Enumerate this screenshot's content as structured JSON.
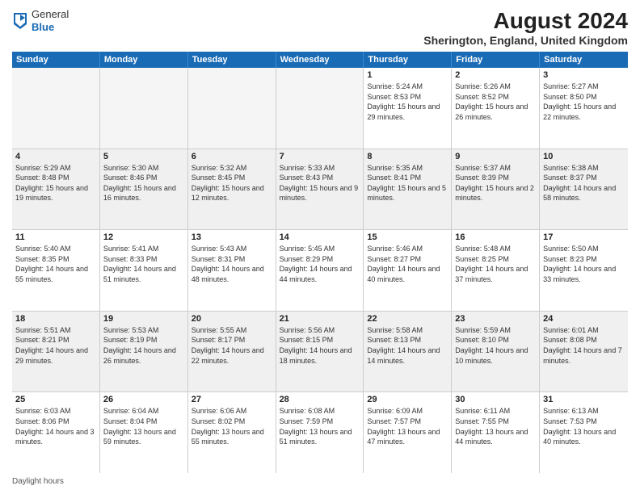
{
  "header": {
    "logo_line1": "General",
    "logo_line2": "Blue",
    "main_title": "August 2024",
    "sub_title": "Sherington, England, United Kingdom"
  },
  "days_of_week": [
    "Sunday",
    "Monday",
    "Tuesday",
    "Wednesday",
    "Thursday",
    "Friday",
    "Saturday"
  ],
  "rows": [
    [
      {
        "day": "",
        "text": "",
        "empty": true
      },
      {
        "day": "",
        "text": "",
        "empty": true
      },
      {
        "day": "",
        "text": "",
        "empty": true
      },
      {
        "day": "",
        "text": "",
        "empty": true
      },
      {
        "day": "1",
        "text": "Sunrise: 5:24 AM\nSunset: 8:53 PM\nDaylight: 15 hours\nand 29 minutes."
      },
      {
        "day": "2",
        "text": "Sunrise: 5:26 AM\nSunset: 8:52 PM\nDaylight: 15 hours\nand 26 minutes."
      },
      {
        "day": "3",
        "text": "Sunrise: 5:27 AM\nSunset: 8:50 PM\nDaylight: 15 hours\nand 22 minutes."
      }
    ],
    [
      {
        "day": "4",
        "text": "Sunrise: 5:29 AM\nSunset: 8:48 PM\nDaylight: 15 hours\nand 19 minutes."
      },
      {
        "day": "5",
        "text": "Sunrise: 5:30 AM\nSunset: 8:46 PM\nDaylight: 15 hours\nand 16 minutes."
      },
      {
        "day": "6",
        "text": "Sunrise: 5:32 AM\nSunset: 8:45 PM\nDaylight: 15 hours\nand 12 minutes."
      },
      {
        "day": "7",
        "text": "Sunrise: 5:33 AM\nSunset: 8:43 PM\nDaylight: 15 hours\nand 9 minutes."
      },
      {
        "day": "8",
        "text": "Sunrise: 5:35 AM\nSunset: 8:41 PM\nDaylight: 15 hours\nand 5 minutes."
      },
      {
        "day": "9",
        "text": "Sunrise: 5:37 AM\nSunset: 8:39 PM\nDaylight: 15 hours\nand 2 minutes."
      },
      {
        "day": "10",
        "text": "Sunrise: 5:38 AM\nSunset: 8:37 PM\nDaylight: 14 hours\nand 58 minutes."
      }
    ],
    [
      {
        "day": "11",
        "text": "Sunrise: 5:40 AM\nSunset: 8:35 PM\nDaylight: 14 hours\nand 55 minutes."
      },
      {
        "day": "12",
        "text": "Sunrise: 5:41 AM\nSunset: 8:33 PM\nDaylight: 14 hours\nand 51 minutes."
      },
      {
        "day": "13",
        "text": "Sunrise: 5:43 AM\nSunset: 8:31 PM\nDaylight: 14 hours\nand 48 minutes."
      },
      {
        "day": "14",
        "text": "Sunrise: 5:45 AM\nSunset: 8:29 PM\nDaylight: 14 hours\nand 44 minutes."
      },
      {
        "day": "15",
        "text": "Sunrise: 5:46 AM\nSunset: 8:27 PM\nDaylight: 14 hours\nand 40 minutes."
      },
      {
        "day": "16",
        "text": "Sunrise: 5:48 AM\nSunset: 8:25 PM\nDaylight: 14 hours\nand 37 minutes."
      },
      {
        "day": "17",
        "text": "Sunrise: 5:50 AM\nSunset: 8:23 PM\nDaylight: 14 hours\nand 33 minutes."
      }
    ],
    [
      {
        "day": "18",
        "text": "Sunrise: 5:51 AM\nSunset: 8:21 PM\nDaylight: 14 hours\nand 29 minutes."
      },
      {
        "day": "19",
        "text": "Sunrise: 5:53 AM\nSunset: 8:19 PM\nDaylight: 14 hours\nand 26 minutes."
      },
      {
        "day": "20",
        "text": "Sunrise: 5:55 AM\nSunset: 8:17 PM\nDaylight: 14 hours\nand 22 minutes."
      },
      {
        "day": "21",
        "text": "Sunrise: 5:56 AM\nSunset: 8:15 PM\nDaylight: 14 hours\nand 18 minutes."
      },
      {
        "day": "22",
        "text": "Sunrise: 5:58 AM\nSunset: 8:13 PM\nDaylight: 14 hours\nand 14 minutes."
      },
      {
        "day": "23",
        "text": "Sunrise: 5:59 AM\nSunset: 8:10 PM\nDaylight: 14 hours\nand 10 minutes."
      },
      {
        "day": "24",
        "text": "Sunrise: 6:01 AM\nSunset: 8:08 PM\nDaylight: 14 hours\nand 7 minutes."
      }
    ],
    [
      {
        "day": "25",
        "text": "Sunrise: 6:03 AM\nSunset: 8:06 PM\nDaylight: 14 hours\nand 3 minutes."
      },
      {
        "day": "26",
        "text": "Sunrise: 6:04 AM\nSunset: 8:04 PM\nDaylight: 13 hours\nand 59 minutes."
      },
      {
        "day": "27",
        "text": "Sunrise: 6:06 AM\nSunset: 8:02 PM\nDaylight: 13 hours\nand 55 minutes."
      },
      {
        "day": "28",
        "text": "Sunrise: 6:08 AM\nSunset: 7:59 PM\nDaylight: 13 hours\nand 51 minutes."
      },
      {
        "day": "29",
        "text": "Sunrise: 6:09 AM\nSunset: 7:57 PM\nDaylight: 13 hours\nand 47 minutes."
      },
      {
        "day": "30",
        "text": "Sunrise: 6:11 AM\nSunset: 7:55 PM\nDaylight: 13 hours\nand 44 minutes."
      },
      {
        "day": "31",
        "text": "Sunrise: 6:13 AM\nSunset: 7:53 PM\nDaylight: 13 hours\nand 40 minutes."
      }
    ]
  ],
  "footer": {
    "text": "Daylight hours"
  }
}
